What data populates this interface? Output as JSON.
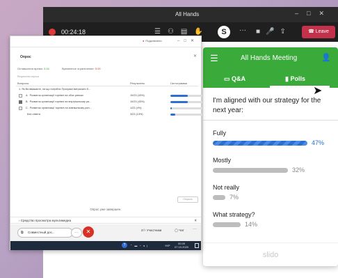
{
  "teams_window": {
    "title": "All Hands",
    "recording_time": "00:24:18",
    "slido_badge": "S",
    "leave_label": "Leave"
  },
  "slido": {
    "meeting_title": "All Hands Meeting",
    "tabs": {
      "qa": "Q&A",
      "polls": "Polls",
      "active": "Polls"
    },
    "question": "I'm aligned with our strategy for the next year:",
    "options": [
      {
        "label": "Fully",
        "percent": "47%",
        "fraction": 0.47,
        "winner": true
      },
      {
        "label": "Mostly",
        "percent": "32%",
        "fraction": 0.32,
        "winner": false
      },
      {
        "label": "Not really",
        "percent": "7%",
        "fraction": 0.07,
        "winner": false
      },
      {
        "label": "What strategy?",
        "percent": "14%",
        "fraction": 0.14,
        "winner": false
      }
    ],
    "footer_logo": "slido",
    "colors": {
      "header": "#3aaa3a",
      "winner_bar": "#2a6fd0"
    }
  },
  "poll_window": {
    "connected_label": "Подключено",
    "heading": "Опрос",
    "remaining_label": "Оставшееся время:",
    "remaining_value": "3:16",
    "time_limit_label": "Временное ограничение:",
    "time_limit_value": "5:00",
    "results_label": "Результаты опроса",
    "columns": {
      "questions": "Вопросы",
      "results": "Результаты",
      "histogram": "Гистограмма"
    },
    "question_title": "1. Як Ви вважаєте, на що потрібно Програмі витрачати б...",
    "rows": [
      {
        "letter": "A.",
        "text": "Розвиток організації торгівлі на обох ринках",
        "result": "10/23 (43%)",
        "fraction": 0.43,
        "checked": false
      },
      {
        "letter": "B.",
        "text": "Розвиток організації торгівлі на внутрішньому ри...",
        "result": "10/23 (43%)",
        "fraction": 0.43,
        "checked": true
      },
      {
        "letter": "C.",
        "text": "Розвиток організації торгівлі на зовнішньому рин...",
        "result": "1/23 (4%)",
        "fraction": 0.04,
        "checked": false
      },
      {
        "letter": "",
        "text": "Без ответа",
        "result": "3/23 (13%)",
        "fraction": 0.13,
        "checked": false
      }
    ],
    "share_label": "Открыть",
    "finished_text": "Опрос уже завершен.",
    "viewer_label": "Средство просмотра мультимедиа",
    "coop_label": "Совместный дос...",
    "participants_label": "Участники",
    "chat_label": "Чат",
    "participants_count": "2",
    "taskbar": {
      "lang": "УКР",
      "time": "00:39",
      "date": "07.10.2020"
    }
  }
}
